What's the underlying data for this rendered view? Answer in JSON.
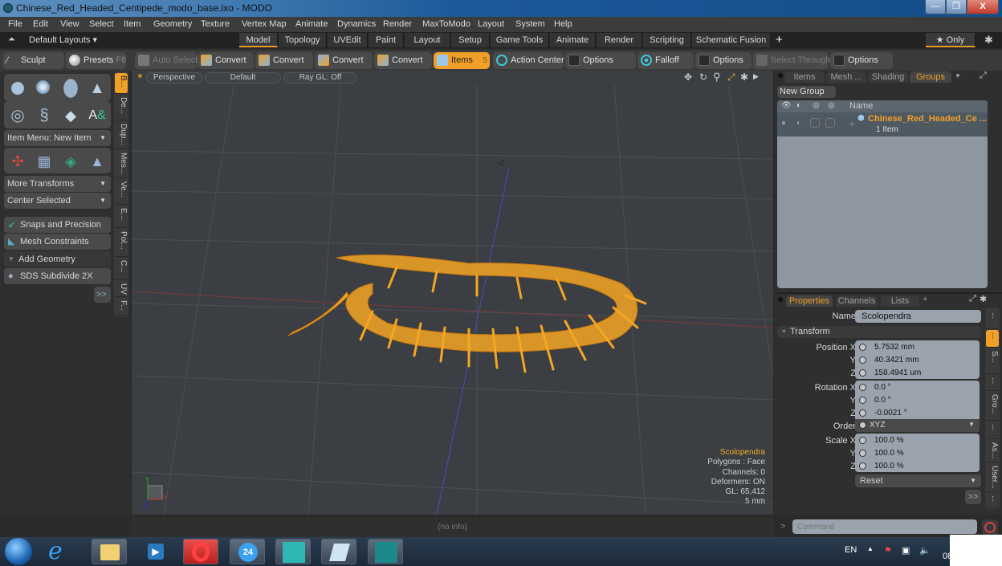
{
  "window": {
    "title": "Chinese_Red_Headed_Centipede_modo_base.lxo - MODO",
    "minimize": "—",
    "maximize": "❐",
    "close": "X"
  },
  "menu": [
    "File",
    "Edit",
    "View",
    "Select",
    "Item",
    "Geometry",
    "Texture",
    "Vertex Map",
    "Animate",
    "Dynamics",
    "Render",
    "MaxToModo",
    "Layout",
    "System",
    "Help"
  ],
  "layouts": {
    "preset": "Default Layouts ▾",
    "tabs": [
      "Model",
      "Topology",
      "UVEdit",
      "Paint",
      "Layout",
      "Setup",
      "Game Tools",
      "Animate",
      "Render",
      "Scripting",
      "Schematic Fusion"
    ],
    "active_tab": "Model",
    "add": "+",
    "only": "★ Only"
  },
  "toolbar": {
    "sculpt": "Sculpt",
    "presets": "Presets",
    "presets_key": "F6",
    "auto_select": "Auto Select",
    "convert1": "Convert",
    "convert2": "Convert",
    "convert3": "Convert",
    "convert4": "Convert",
    "items": "Items",
    "items_count": "5",
    "action_center": "Action Center",
    "options1": "Options",
    "falloff": "Falloff",
    "options2": "Options",
    "select_through": "Select Through",
    "options3": "Options"
  },
  "leftpanel": {
    "item_menu": "Item Menu: New Item",
    "more_transforms": "More Transforms",
    "center_selected": "Center Selected",
    "snaps": "Snaps and Precision",
    "mesh_constraints": "Mesh Constraints",
    "add_geometry": "Add Geometry",
    "sds": "SDS Subdivide 2X",
    "more": ">>",
    "vtabs": [
      "B...",
      "De...",
      "Dup...",
      "Mes...",
      "Ve...",
      "E...",
      "Pol...",
      "C...",
      "UV",
      "F..."
    ]
  },
  "viewport": {
    "view": "Perspective",
    "shading": "Default",
    "raygl": "Ray GL: Off",
    "axis_label": "-Z",
    "hud": {
      "item": "Scolopendra",
      "polygons": "Polygons : Face",
      "channels": "Channels: 0",
      "deformers": "Deformers: ON",
      "gl": "GL: 65,412",
      "scale": "5 mm"
    },
    "status": "(no info)"
  },
  "groups_panel": {
    "tabs": [
      "Items",
      "Mesh ...",
      "Shading",
      "Groups"
    ],
    "active_tab": "Groups",
    "new_group": "New Group",
    "col_name": "Name",
    "row": {
      "name": "Chinese_Red_Headed_Ce ...",
      "sub": "1 Item"
    }
  },
  "properties": {
    "tabs": [
      "Properties",
      "Channels",
      "Lists"
    ],
    "active_tab": "Properties",
    "name_label": "Name",
    "name_value": "Scolopendra",
    "section": "Transform",
    "position": {
      "label": "Position X",
      "x": "5.7532 mm",
      "y": "40.3421 mm",
      "z": "158.4941 um"
    },
    "rotation": {
      "label": "Rotation X",
      "x": "0.0 °",
      "y": "0.0 °",
      "z": "-0.0021 °"
    },
    "order": {
      "label": "Order",
      "value": "XYZ"
    },
    "scale": {
      "label": "Scale X",
      "x": "100.0 %",
      "y": "100.0 %",
      "z": "100.0 %"
    },
    "y_label": "Y",
    "z_label": "Z",
    "reset": "Reset",
    "more": ">>",
    "vtabs": [
      "...",
      "...",
      "S...",
      "...",
      "Gro...",
      "...",
      "As...",
      "User...",
      "..."
    ]
  },
  "command": {
    "placeholder": "Command",
    "prompt": ">"
  },
  "taskbar": {
    "lang": "EN",
    "clock": "08"
  }
}
